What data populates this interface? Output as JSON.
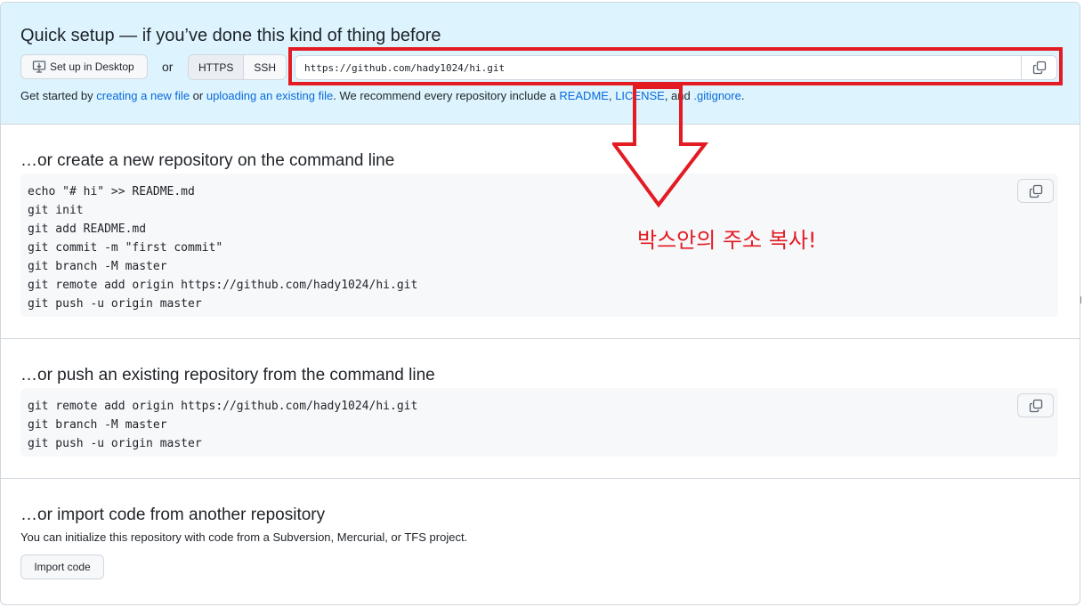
{
  "quick_setup": {
    "title": "Quick setup — if you’ve done this kind of thing before",
    "desktop_button": "Set up in Desktop",
    "or": "or",
    "protocols": [
      "HTTPS",
      "SSH"
    ],
    "url": "https://github.com/hady1024/hi.git",
    "get_started": {
      "t1": "Get started by ",
      "link1": "creating a new file",
      "t2": " or ",
      "link2": "uploading an existing file",
      "t3": ". We recommend every repository include a ",
      "link3": "README",
      "t4": ", ",
      "link4": "LICENSE",
      "t5": ", and ",
      "link5": ".gitignore",
      "t6": "."
    }
  },
  "create_section": {
    "title": "…or create a new repository on the command line",
    "code": "echo \"# hi\" >> README.md\ngit init\ngit add README.md\ngit commit -m \"first commit\"\ngit branch -M master\ngit remote add origin https://github.com/hady1024/hi.git\ngit push -u origin master"
  },
  "push_section": {
    "title": "…or push an existing repository from the command line",
    "code": "git remote add origin https://github.com/hady1024/hi.git\ngit branch -M master\ngit push -u origin master"
  },
  "import_section": {
    "title": "…or import code from another repository",
    "description": "You can initialize this repository with code from a Subversion, Mercurial, or TFS project.",
    "button": "Import code"
  },
  "annotation": {
    "text": "박스안의 주소 복사!",
    "color": "#e31b23"
  },
  "colors": {
    "link": "#0969da",
    "quick_bg": "#ddf4ff",
    "code_bg": "#f6f8fa"
  }
}
